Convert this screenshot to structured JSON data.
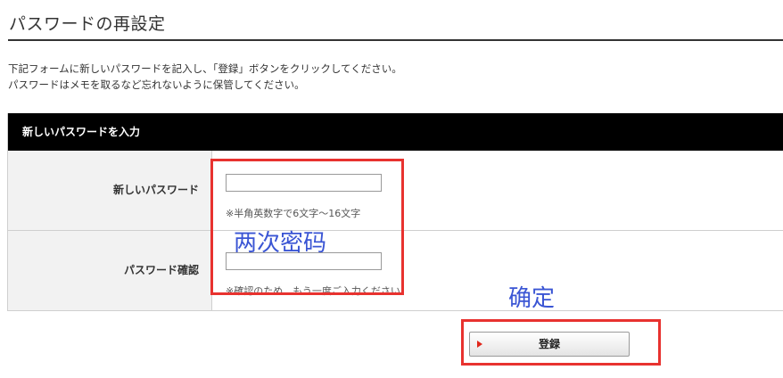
{
  "page": {
    "title": "パスワードの再設定"
  },
  "instructions": {
    "line1": "下記フォームに新しいパスワードを記入し、「登録」ボタンをクリックしてください。",
    "line2": "パスワードはメモを取るなど忘れないように保管してください。"
  },
  "form": {
    "header": "新しいパスワードを入力",
    "fields": [
      {
        "label": "新しいパスワード",
        "value": "",
        "hint": "※半角英数字で6文字～16文字"
      },
      {
        "label": "パスワード確認",
        "value": "",
        "hint": "※確認のため、もう一度ご入力ください"
      }
    ],
    "submit_label": "登録"
  },
  "annotations": {
    "fields_note": "两次密码",
    "button_note": "确定",
    "box_color": "#e8322f",
    "text_color": "#3a55d4"
  },
  "colors": {
    "header_bg": "#000000",
    "label_bg": "#f2f2f2",
    "arrow": "#e0281c"
  },
  "icons": {
    "submit_arrow": "play-arrow-icon"
  }
}
